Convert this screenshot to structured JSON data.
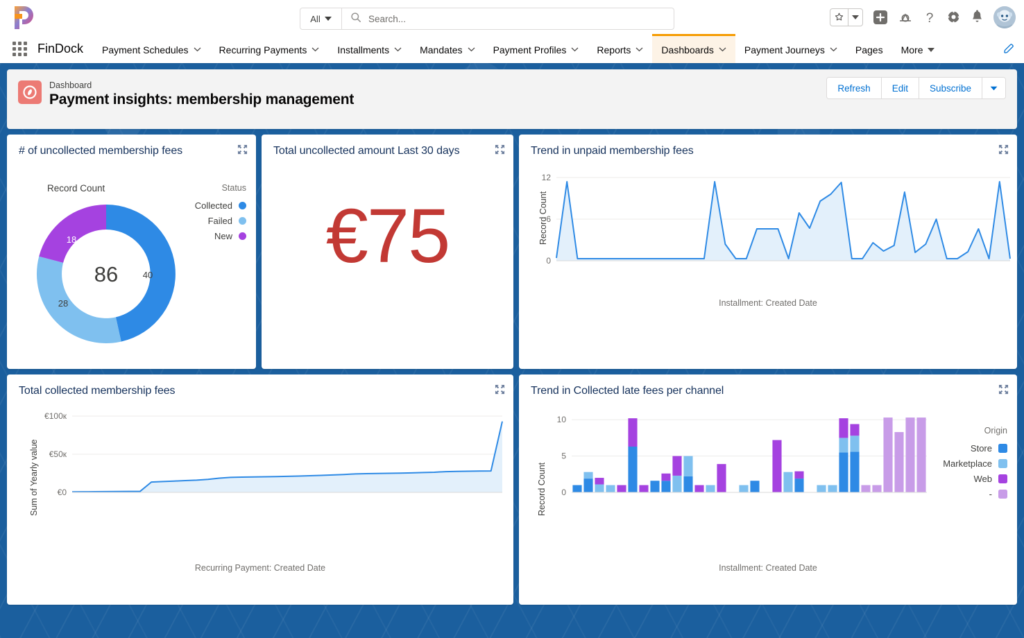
{
  "header": {
    "logo_name": "findock-logo",
    "search": {
      "scope": "All",
      "placeholder": "Search...",
      "value": ""
    },
    "icons": [
      "favorites-star-icon",
      "favorites-caret-icon",
      "add-icon",
      "trailhead-icon",
      "help-icon",
      "setup-gear-icon",
      "notifications-bell-icon",
      "user-avatar"
    ]
  },
  "appnav": {
    "app_name": "FinDock",
    "items": [
      {
        "label": "Payment Schedules",
        "has_caret": true,
        "active": false
      },
      {
        "label": "Recurring Payments",
        "has_caret": true,
        "active": false
      },
      {
        "label": "Installments",
        "has_caret": true,
        "active": false
      },
      {
        "label": "Mandates",
        "has_caret": true,
        "active": false
      },
      {
        "label": "Payment Profiles",
        "has_caret": true,
        "active": false
      },
      {
        "label": "Reports",
        "has_caret": true,
        "active": false
      },
      {
        "label": "Dashboards",
        "has_caret": true,
        "active": true
      },
      {
        "label": "Payment Journeys",
        "has_caret": true,
        "active": false
      },
      {
        "label": "Pages",
        "has_caret": false,
        "active": false
      },
      {
        "label": "More",
        "has_caret": true,
        "active": false
      }
    ]
  },
  "dashboard": {
    "eyebrow": "Dashboard",
    "title": "Payment insights: membership management",
    "actions": [
      "Refresh",
      "Edit",
      "Subscribe"
    ]
  },
  "widgets": {
    "donut": {
      "title": "# of uncollected membership fees",
      "measure": "Record Count",
      "legend_title": "Status",
      "center": "86"
    },
    "metric": {
      "title": "Total uncollected amount Last 30 days",
      "value": "€75"
    },
    "trend_unpaid": {
      "title": "Trend in unpaid membership fees",
      "ylabel": "Record Count",
      "xlabel": "Installment: Created Date"
    },
    "collected": {
      "title": "Total collected membership fees",
      "ylabel": "Sum of Yearly value",
      "xlabel": "Recurring Payment: Created Date"
    },
    "late_fees": {
      "title": "Trend in Collected late fees per channel",
      "ylabel": "Record Count",
      "xlabel": "Installment: Created Date",
      "legend_title": "Origin"
    }
  },
  "colors": {
    "blue": "#2e8ae5",
    "light_blue": "#7fc0ef",
    "purple": "#a542e0",
    "light_purple": "#c89ce8",
    "red": "#c23934",
    "brand_blue": "#1b5f9e",
    "accent_orange": "#f59b00",
    "link": "#0070d2"
  },
  "chart_data": [
    {
      "type": "pie",
      "title": "# of uncollected membership fees",
      "subtitle": "Record Count",
      "legend_title": "Status",
      "legend_position": "right",
      "total": 86,
      "labels": [
        "Collected",
        "Failed",
        "New"
      ],
      "values": [
        40,
        28,
        18
      ],
      "colors": [
        "#2e8ae5",
        "#7fc0ef",
        "#a542e0"
      ],
      "center_label": "86"
    },
    {
      "type": "metric",
      "title": "Total uncollected amount Last 30 days",
      "value": 75,
      "display": "€75",
      "color": "#c23934"
    },
    {
      "type": "area",
      "title": "Trend in unpaid membership fees",
      "xlabel": "Installment: Created Date",
      "ylabel": "Record Count",
      "ylim": [
        0,
        12
      ],
      "yticks": [
        0,
        6,
        12
      ],
      "grid": true,
      "line_color": "#2e8ae5",
      "fill_color": "#e3f0fb",
      "values": [
        0.4,
        11.4,
        0.3,
        0.3,
        0.3,
        0.3,
        0.3,
        0.3,
        0.3,
        0.3,
        0.3,
        0.3,
        0.3,
        0.3,
        0.3,
        11.4,
        2.4,
        0.3,
        0.3,
        4.6,
        4.6,
        4.6,
        0.3,
        6.9,
        4.7,
        8.6,
        9.6,
        11.3,
        0.3,
        0.3,
        2.6,
        1.4,
        2.2,
        9.9,
        1.2,
        2.4,
        6.0,
        0.3,
        0.3,
        1.3,
        4.6,
        0.3,
        11.4,
        0.3
      ]
    },
    {
      "type": "area",
      "title": "Total collected membership fees",
      "xlabel": "Recurring Payment: Created Date",
      "ylabel": "Sum of Yearly value",
      "ylim": [
        0,
        100000
      ],
      "yticks": [
        0,
        50000,
        100000
      ],
      "yticklabels": [
        "€0",
        "€50к",
        "€100к"
      ],
      "grid": true,
      "line_color": "#2e8ae5",
      "fill_color": "#e3f0fb",
      "values": [
        700,
        800,
        900,
        1000,
        1100,
        1200,
        1300,
        13500,
        14200,
        14800,
        15400,
        16000,
        17000,
        18600,
        19700,
        20000,
        20200,
        20400,
        20700,
        21000,
        21400,
        21800,
        22300,
        22800,
        23400,
        24200,
        24600,
        24800,
        25000,
        25200,
        25600,
        26000,
        26400,
        27200,
        27500,
        27700,
        27900,
        28100,
        93000
      ]
    },
    {
      "type": "bar",
      "stacked": true,
      "title": "Trend in Collected late fees per channel",
      "xlabel": "Installment: Created Date",
      "ylabel": "Record Count",
      "legend_title": "Origin",
      "legend_position": "right",
      "ylim": [
        0,
        10.5
      ],
      "yticks": [
        0,
        5,
        10
      ],
      "grid": true,
      "series": [
        {
          "name": "Store",
          "color": "#2e8ae5",
          "values": [
            1,
            1.9,
            0,
            0,
            0,
            6.3,
            0,
            1.6,
            1.6,
            0,
            2.2,
            0,
            0,
            0,
            0,
            0,
            1.6,
            0,
            0,
            0,
            1.9,
            0,
            0,
            0,
            5.5,
            5.6,
            0,
            0,
            0,
            0,
            0,
            0
          ]
        },
        {
          "name": "Marketplace",
          "color": "#7fc0ef",
          "values": [
            0,
            0.9,
            1.1,
            1,
            0,
            0,
            0,
            0,
            0,
            2.3,
            2.8,
            0,
            1,
            0,
            0,
            1,
            0,
            0,
            0,
            2.8,
            0,
            0,
            1,
            1,
            2.0,
            2.2,
            0,
            0,
            0,
            0,
            0,
            0
          ]
        },
        {
          "name": "Web",
          "color": "#a542e0",
          "values": [
            0,
            0,
            0.9,
            0,
            1,
            3.9,
            1,
            0,
            1,
            2.7,
            0,
            1,
            0,
            3.9,
            0,
            0,
            0,
            0,
            7.2,
            0,
            1,
            0,
            0,
            0,
            2.7,
            1.6,
            0,
            0,
            0,
            0,
            0,
            0
          ]
        },
        {
          "name": "-",
          "color": "#c89ce8",
          "values": [
            0,
            0,
            0,
            0,
            0,
            0,
            0,
            0,
            0,
            0,
            0,
            0,
            0,
            0,
            0,
            0,
            0,
            0,
            0,
            0,
            0,
            0,
            0,
            0,
            0,
            0,
            1,
            1,
            10.3,
            8.3,
            10.3,
            10.3
          ]
        }
      ]
    }
  ]
}
